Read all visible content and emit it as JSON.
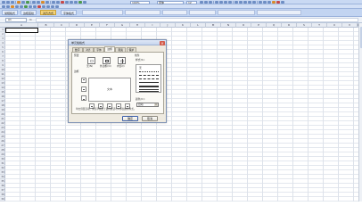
{
  "toolbar": {
    "font_name": "宋体",
    "font_size": "12",
    "zoom": "100%",
    "tabs": [
      "常规格式",
      "边框底纹",
      "对齐方式",
      "字体格式"
    ]
  },
  "formula_bar": {
    "name_box": "A1",
    "fx": "fx",
    "content": ""
  },
  "grid": {
    "columns": [
      "A",
      "B",
      "C",
      "D",
      "E",
      "F",
      "G",
      "H",
      "I",
      "J",
      "K",
      "L",
      "M",
      "N",
      "O",
      "P",
      "Q",
      "R",
      "S",
      "T",
      "U",
      "V",
      "W"
    ],
    "rows": [
      "1",
      "2",
      "3",
      "4",
      "5",
      "6",
      "7",
      "8",
      "9",
      "10",
      "11",
      "12",
      "13",
      "14",
      "15",
      "16",
      "17",
      "18",
      "19",
      "20",
      "21",
      "22",
      "23",
      "24",
      "25",
      "26",
      "27",
      "28",
      "29",
      "30",
      "31",
      "32",
      "33",
      "34",
      "35",
      "36",
      "37",
      "38",
      "39"
    ]
  },
  "dialog": {
    "title": "单元格格式",
    "close": "×",
    "tabs": [
      "数字",
      "对齐",
      "字体",
      "边框",
      "图案",
      "保护"
    ],
    "active_tab": "边框",
    "preset_label": "预置",
    "presets": [
      "无(N)",
      "外边框(O)",
      "内部(I)"
    ],
    "border_label": "边框",
    "line_label": "线条",
    "style_label": "样式(S):",
    "style_none": "无",
    "color_label": "颜色(C):",
    "color_value": "自动",
    "preview_text": "文本",
    "note": "单击预置选项、预览草图及上面的按钮可以添加边框样式。",
    "ok": "确定",
    "cancel": "取消"
  }
}
